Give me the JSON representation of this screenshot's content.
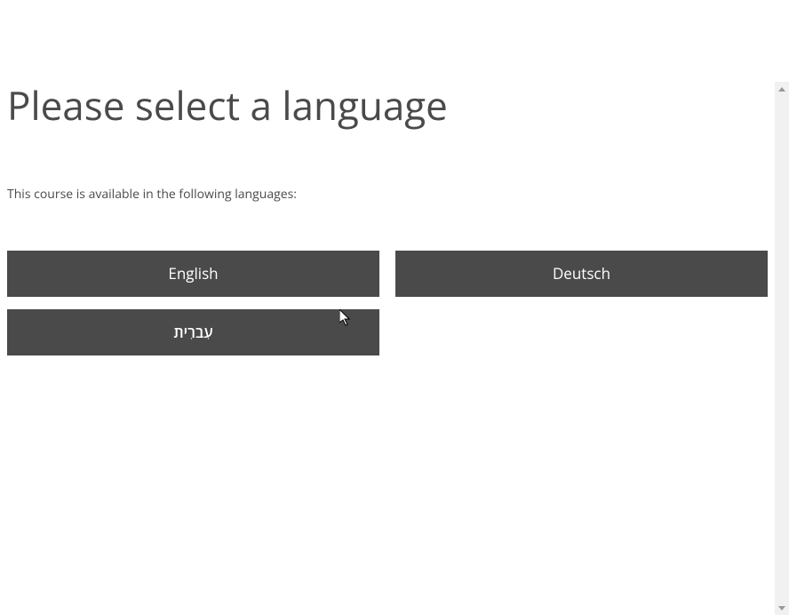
{
  "title": "Please select a language",
  "subtitle": "This course is available in the following languages:",
  "languages": {
    "0": "English",
    "1": "Deutsch",
    "2": "עִברִית"
  }
}
